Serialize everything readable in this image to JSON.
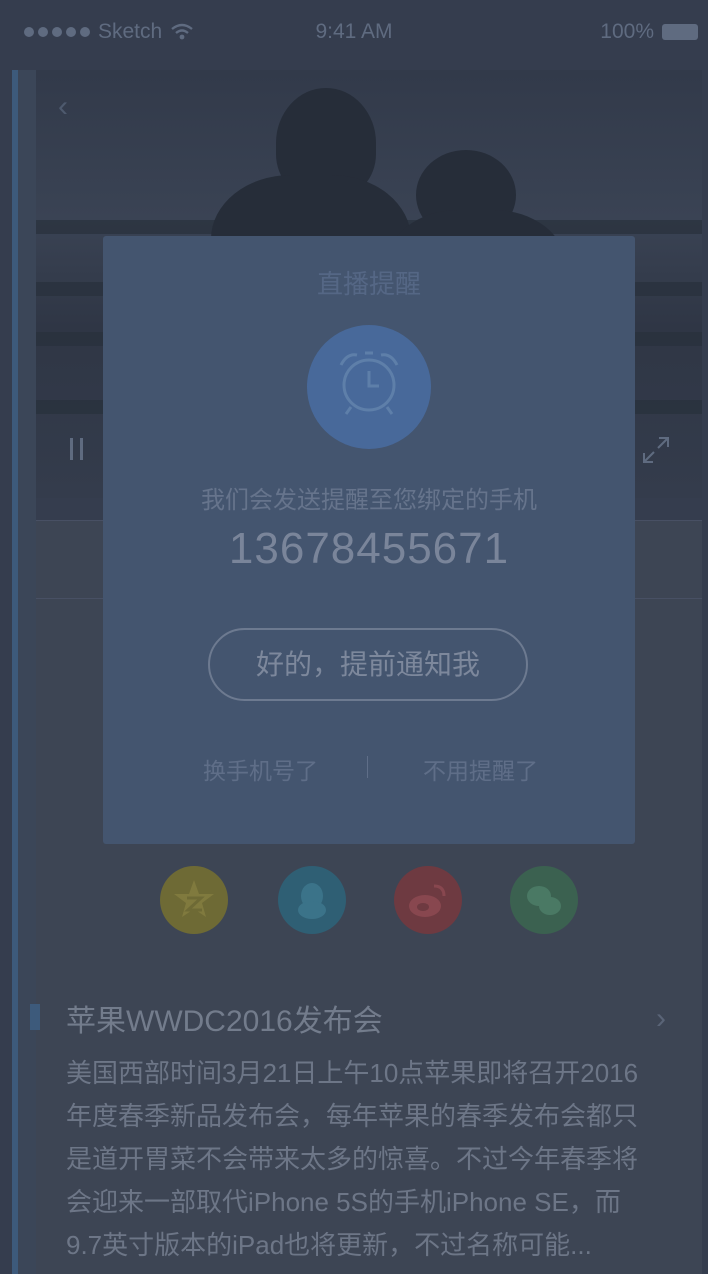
{
  "status_bar": {
    "carrier": "Sketch",
    "time": "9:41 AM",
    "battery": "100%"
  },
  "modal": {
    "title": "直播提醒",
    "message": "我们会发送提醒至您绑定的手机",
    "phone": "13678455671",
    "confirm_label": "好的，提前通知我",
    "change_phone_label": "换手机号了",
    "dismiss_label": "不用提醒了"
  },
  "article": {
    "title": "苹果WWDC2016发布会",
    "lines": [
      "美国西部时间3月21日上午10点苹果即将召开2016",
      "年度春季新品发布会，每年苹果的春季发布会都只",
      "是道开胃菜不会带来太多的惊喜。不过今年春季将",
      "会迎来一部取代iPhone 5S的手机iPhone SE，而",
      "9.7英寸版本的iPad也将更新，不过名称可能..."
    ]
  },
  "share": [
    {
      "icon": "qzone-icon",
      "color": "#6e6a35"
    },
    {
      "icon": "qq-icon",
      "color": "#2f5f74"
    },
    {
      "icon": "weibo-icon",
      "color": "#6e3a41"
    },
    {
      "icon": "wechat-icon",
      "color": "#3b6150"
    }
  ]
}
